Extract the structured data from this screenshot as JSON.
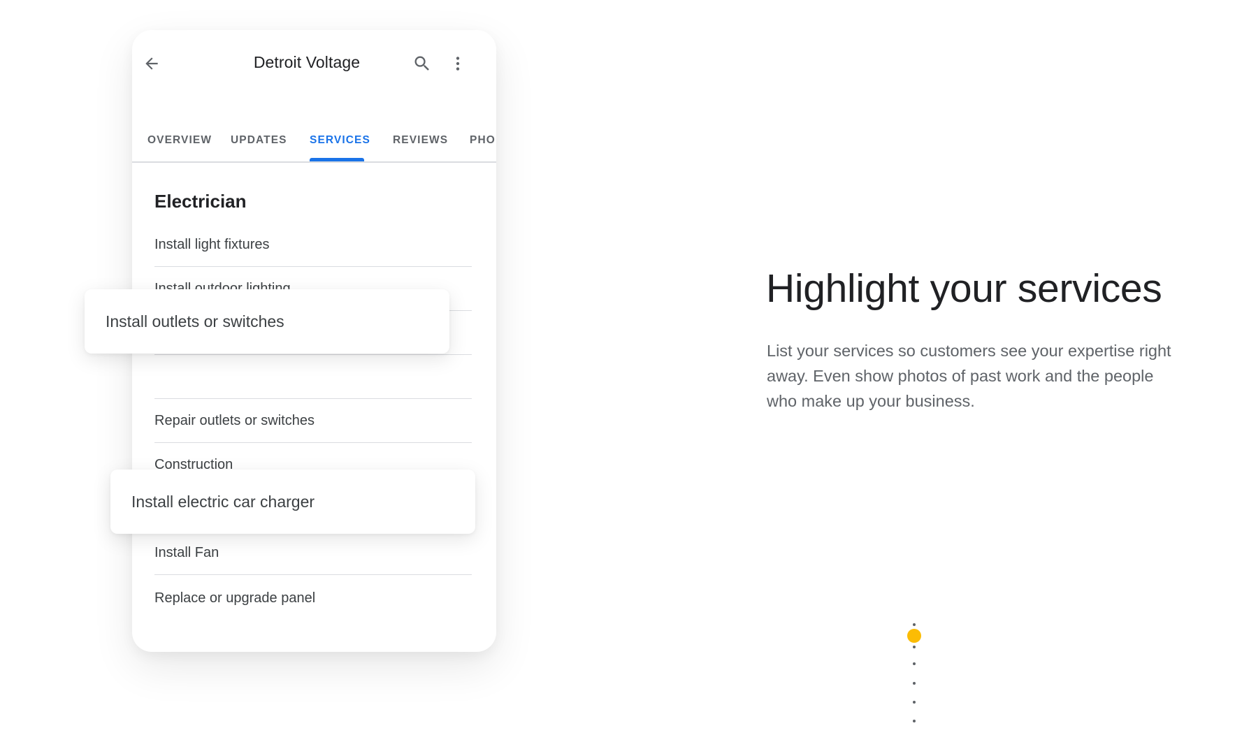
{
  "appbar": {
    "title": "Detroit Voltage",
    "icons": [
      "arrow-back-icon",
      "search-icon",
      "more-vert-icon"
    ]
  },
  "tabs": [
    {
      "label": "OVERVIEW",
      "active": false
    },
    {
      "label": "UPDATES",
      "active": false
    },
    {
      "label": "SERVICES",
      "active": true
    },
    {
      "label": "REVIEWS",
      "active": false
    },
    {
      "label": "PHO",
      "active": false
    }
  ],
  "services": {
    "category": "Electrician",
    "items": [
      "Install light fixtures",
      "Install outdoor lighting",
      "Repair outlets or switches",
      "Construction",
      "Install Fan",
      "Replace or upgrade panel"
    ]
  },
  "floating_chips": [
    "Install outlets or switches",
    "Install electric car charger"
  ],
  "hero": {
    "headline": "Highlight your services",
    "body": "List your services so customers see your expertise right away. Even show photos of past work and the people who make up your business."
  },
  "pager": {
    "active_index": 0,
    "count": 6
  },
  "colors": {
    "accent": "#1a73e8",
    "pager_active": "#fbbc04",
    "text_primary": "#202124",
    "text_secondary": "#5f6368",
    "divider": "#dadce0"
  }
}
